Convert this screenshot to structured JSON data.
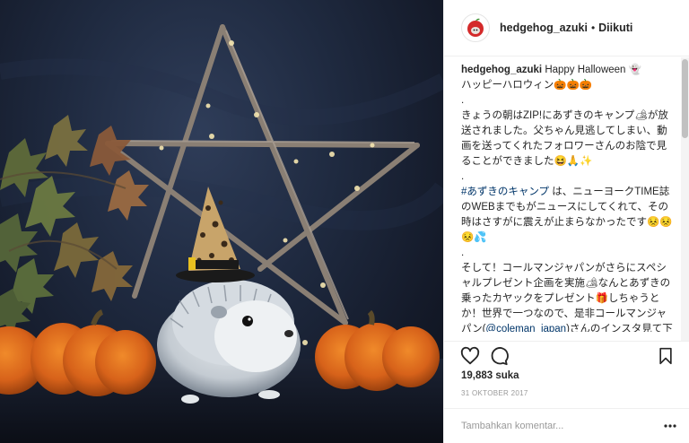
{
  "post": {
    "username": "hedgehog_azuki",
    "separator": "•",
    "follow_status": "Diikuti",
    "likes": "19,883 suka",
    "date": "31 OKTOBER 2017",
    "comment_placeholder": "Tambahkan komentar..."
  },
  "caption": {
    "username": "hedgehog_azuki",
    "line1": "Happy Halloween 👻",
    "line2": "ハッピーハロウィン🎃🎃🎃",
    "dot1": ".",
    "para1": "きょうの朝はZIP!にあずきのキャンプ🏕が放送されました。父ちゃん見逃してしまい、動画を送ってくれたフォロワーさんのお陰で見ることができました😆🙏✨",
    "dot2": ".",
    "hashtag": "#あずきのキャンプ",
    "para2": " は、ニューヨークTIME誌のWEBまでもがニュースにしてくれて、その時はさすがに震えが止まらなかったです😣😣😣💦",
    "dot3": ".",
    "para3a": "そして！コールマンジャパンがさらにスペシャルプレゼント企画を実施🏕なんとあずきの乗ったカヤックをプレゼント🎁しちゃうとか！世界で一つなので、是非コールマンジャパン(",
    "mention": "@coleman_japan",
    "para3b": ")さんのインスタ見て下さい〜😆",
    "dot4": "."
  },
  "icons": {
    "avatar": "hedgehog-apple-avatar",
    "like": "heart-icon",
    "comment": "comment-bubble-icon",
    "save": "bookmark-icon",
    "more": "more-options-icon"
  }
}
